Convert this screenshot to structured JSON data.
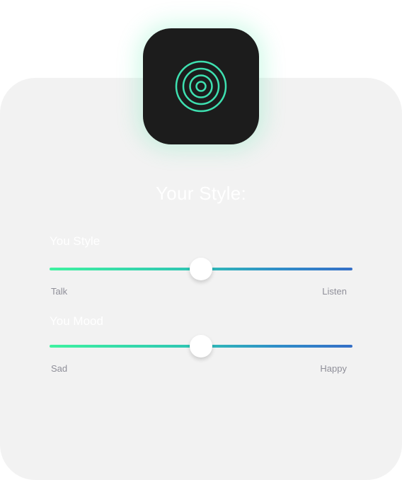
{
  "app": {
    "icon": "concentric-rings-icon",
    "accent_color": "#3ef2a0",
    "gradient_end_color": "#356fc7"
  },
  "title": "Your Style:",
  "sliders": [
    {
      "label": "You Style",
      "min_label": "Talk",
      "max_label": "Listen",
      "value_fraction": 0.5
    },
    {
      "label": "You Mood",
      "min_label": "Sad",
      "max_label": "Happy",
      "value_fraction": 0.5
    }
  ]
}
